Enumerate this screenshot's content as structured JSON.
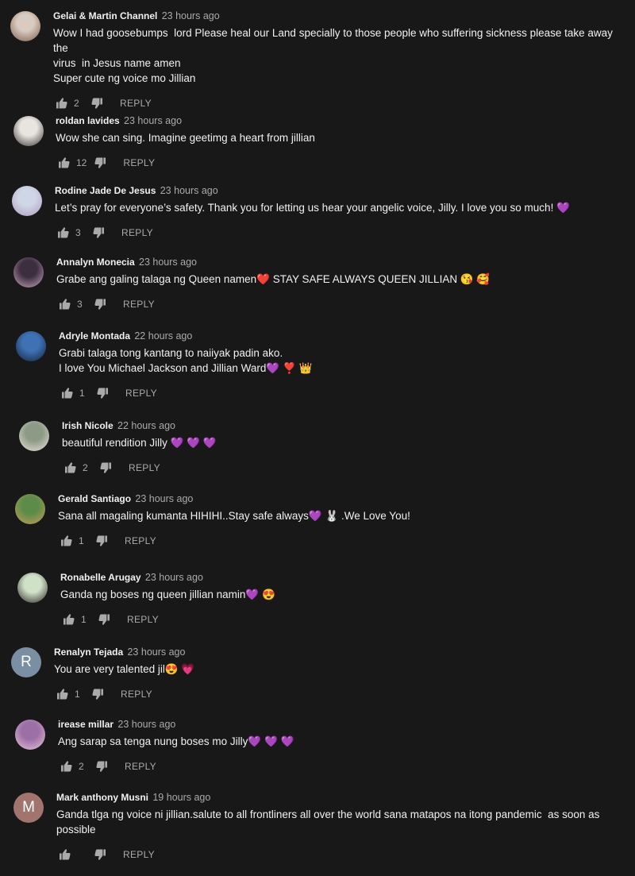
{
  "colors": {
    "background": "#181818",
    "text": "#f1f1f1",
    "muted": "#aaaaaa",
    "heart_purple": "#9b59d0",
    "heart_red": "#e0244a"
  },
  "reply_label": "REPLY",
  "comments": [
    {
      "author": "Gelai & Martin Channel",
      "time": "23 hours ago",
      "lines": [
        "Wow I had goosebumps  lord Please heal our Land specially to those people who suffering sickness please take away the",
        "virus  in Jesus name amen",
        "Super cute ng voice mo Jillian"
      ],
      "likes": "2",
      "avatar": {
        "type": "photo",
        "colors": [
          "#d9cbc0",
          "#7a5a48"
        ]
      }
    },
    {
      "author": "roldan lavides",
      "time": "23 hours ago",
      "lines": [
        "Wow she can sing. Imagine geetimg a heart from jillian"
      ],
      "likes": "12",
      "avatar": {
        "type": "photo",
        "colors": [
          "#e8e4e0",
          "#3a3533"
        ]
      }
    },
    {
      "author": "Rodine Jade De Jesus",
      "time": "23 hours ago",
      "lines": [
        "Let’s pray for everyone’s safety. Thank you for letting us hear your angelic voice, Jilly. I love you so much! 💜"
      ],
      "likes": "3",
      "avatar": {
        "type": "photo",
        "colors": [
          "#cfd6e6",
          "#b09bc0"
        ]
      }
    },
    {
      "author": "Annalyn Monecia",
      "time": "23 hours ago",
      "lines": [
        "Grabe ang galing talaga ng Queen namen❤️ STAY SAFE ALWAYS QUEEN JILLIAN 😘 🥰"
      ],
      "likes": "3",
      "avatar": {
        "type": "photo",
        "colors": [
          "#3d2e3f",
          "#c9a6c2"
        ]
      }
    },
    {
      "author": "Adryle Montada",
      "time": "22 hours ago",
      "lines": [
        "Grabi talaga tong kantang to naiiyak padin ako.",
        "I love You Michael Jackson and Jillian Ward💜 ❣️ 👑"
      ],
      "likes": "1",
      "avatar": {
        "type": "photo",
        "colors": [
          "#3f72b5",
          "#14223a"
        ]
      }
    },
    {
      "author": "Irish Nicole",
      "time": "22 hours ago",
      "lines": [
        "beautiful rendition Jilly 💜 💜 💜"
      ],
      "likes": "2",
      "avatar": {
        "type": "photo",
        "colors": [
          "#8c9a86",
          "#ece4da"
        ]
      }
    },
    {
      "author": "Gerald Santiago",
      "time": "23 hours ago",
      "lines": [
        "Sana all magaling kumanta HIHIHI..Stay safe always💜 🐰 .We Love You!"
      ],
      "likes": "1",
      "avatar": {
        "type": "photo",
        "colors": [
          "#5d8c4a",
          "#c89b5a"
        ]
      }
    },
    {
      "author": "Ronabelle Arugay",
      "time": "23 hours ago",
      "lines": [
        "Ganda ng boses ng queen jillian namin💜 😍"
      ],
      "likes": "1",
      "avatar": {
        "type": "photo",
        "colors": [
          "#cfe2c8",
          "#2f2622"
        ]
      }
    },
    {
      "author": "Renalyn Tejada",
      "time": "23 hours ago",
      "lines": [
        "You are very talented jil😍 💗"
      ],
      "likes": "1",
      "avatar": {
        "type": "letter",
        "letter": "R",
        "colors": [
          "#7a8fa3"
        ]
      }
    },
    {
      "author": "irease millar",
      "time": "23 hours ago",
      "lines": [
        "Ang sarap sa tenga nung boses mo Jilly💜 💜 💜"
      ],
      "likes": "2",
      "avatar": {
        "type": "photo",
        "colors": [
          "#9c6fa6",
          "#e9c4d8"
        ]
      }
    },
    {
      "author": "Mark anthony Musni",
      "time": "19 hours ago",
      "lines": [
        "Ganda tlga ng voice ni jillian.salute to all frontliners all over the world sana matapos na itong pandemic  as soon as",
        "possible"
      ],
      "likes": "",
      "avatar": {
        "type": "letter",
        "letter": "M",
        "colors": [
          "#a1756d"
        ]
      }
    }
  ]
}
